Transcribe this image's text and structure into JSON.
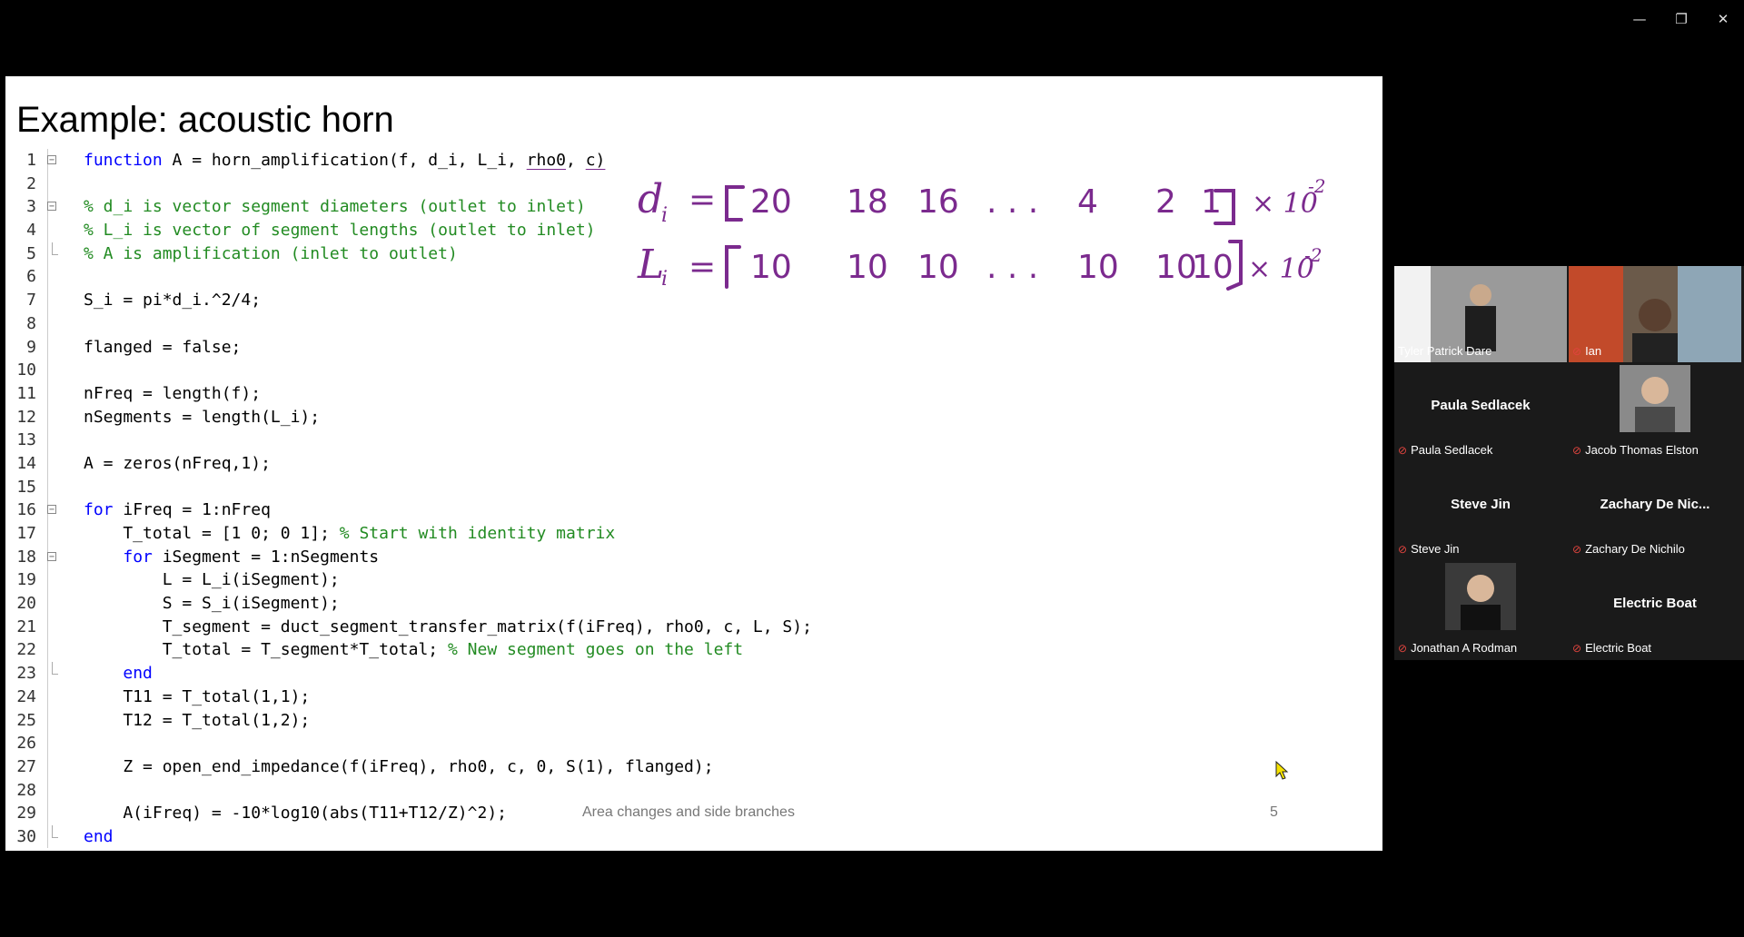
{
  "window": {
    "minimize": "—",
    "restore": "❐",
    "close": "✕"
  },
  "slide": {
    "title": "Example: acoustic horn",
    "footer": "Area changes and side branches",
    "page_number": "5"
  },
  "code": {
    "line_numbers": [
      "1",
      "2",
      "3",
      "4",
      "5",
      "6",
      "7",
      "8",
      "9",
      "10",
      "11",
      "12",
      "13",
      "14",
      "15",
      "16",
      "17",
      "18",
      "19",
      "20",
      "21",
      "22",
      "23",
      "24",
      "25",
      "26",
      "27",
      "28",
      "29",
      "30"
    ],
    "l1_kw": "function",
    "l1_a": " A = horn_amplification(f, d_i, L_i, ",
    "l1_rho": "rho0",
    "l1_b": ", ",
    "l1_c": "c)",
    "l3": "% d_i is vector segment diameters (outlet to inlet)",
    "l4": "% L_i is vector of segment lengths (outlet to inlet)",
    "l5": "% A is amplification (inlet to outlet)",
    "l7": "S_i = pi*d_i.^2/4;",
    "l9": "flanged = false;",
    "l11": "nFreq = length(f);",
    "l12": "nSegments = length(L_i);",
    "l14": "A = zeros(nFreq,1);",
    "l16_kw": "for",
    "l16": " iFreq = 1:nFreq",
    "l17": "    T_total = [1 0; 0 1]; ",
    "l17_cm": "% Start with identity matrix",
    "l18_kw": "for",
    "l18": " iSegment = 1:nSegments",
    "l19": "        L = L_i(iSegment);",
    "l20": "        S = S_i(iSegment);",
    "l21": "        T_segment = duct_segment_transfer_matrix(f(iFreq), rho0, c, L, S);",
    "l22": "        T_total = T_segment*T_total; ",
    "l22_cm": "% New segment goes on the left",
    "l23_kw": "end",
    "l24": "    T11 = T_total(1,1);",
    "l25": "    T12 = T_total(1,2);",
    "l27": "    Z = open_end_impedance(f(iFreq), rho0, c, 0, S(1), flanged);",
    "l29": "    A(iFreq) = -10*log10(abs(T11+T12/Z)^2);",
    "l30_kw": "end"
  },
  "annotations": {
    "ink_color": "#7b2a8e",
    "d_label": "d",
    "d_sub": "i",
    "d_values": [
      "20",
      "18",
      "16",
      ". . .",
      "4",
      "2",
      "1"
    ],
    "L_label": "L",
    "L_sub": "i",
    "L_values": [
      "10",
      "10",
      "10",
      ". . .",
      "10",
      "10",
      "10"
    ],
    "eq": "=",
    "times": "× 10",
    "exponent": "-2"
  },
  "participants": [
    {
      "name": "Tyler Patrick Dare",
      "display": "",
      "muted": false,
      "video": true,
      "active": true
    },
    {
      "name": "Ian",
      "display": "",
      "muted": true,
      "video": true,
      "active": false
    },
    {
      "name": "Paula Sedlacek",
      "display": "Paula Sedlacek",
      "muted": true,
      "video": false,
      "active": false
    },
    {
      "name": "Jacob Thomas Elston",
      "display": "",
      "muted": true,
      "video": false,
      "avatar": true,
      "active": false
    },
    {
      "name": "Steve Jin",
      "display": "Steve Jin",
      "muted": true,
      "video": false,
      "active": false
    },
    {
      "name": "Zachary De Nichilo",
      "display": "Zachary De Nic...",
      "muted": true,
      "video": false,
      "active": false
    },
    {
      "name": "Jonathan A Rodman",
      "display": "",
      "muted": true,
      "video": false,
      "avatar": true,
      "active": false
    },
    {
      "name": "Electric Boat",
      "display": "Electric Boat",
      "muted": true,
      "video": false,
      "active": false
    }
  ],
  "colors": {
    "keyword": "#0000ff",
    "comment": "#228b22",
    "speaker_border": "#23d96e",
    "muted_mic": "#e0443e"
  }
}
